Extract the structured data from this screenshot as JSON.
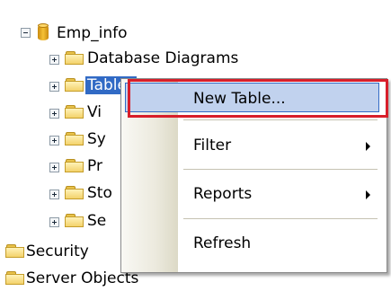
{
  "tree": {
    "root": {
      "label": "Emp_info",
      "expanded": true
    },
    "children": [
      {
        "label": "Database Diagrams"
      },
      {
        "label": "Tables",
        "selected": true,
        "visible_text": "Tables"
      },
      {
        "label": "Vi"
      },
      {
        "label": "Sy"
      },
      {
        "label": "Pr"
      },
      {
        "label": "Sto"
      },
      {
        "label": "Se"
      }
    ],
    "siblings": [
      {
        "label": "Security"
      },
      {
        "label": "Server Objects"
      }
    ]
  },
  "context_menu": {
    "items": [
      {
        "label": "New Table...",
        "highlighted": true
      },
      {
        "label": "Filter",
        "submenu": true
      },
      {
        "label": "Reports",
        "submenu": true
      },
      {
        "label": "Refresh"
      }
    ]
  },
  "colors": {
    "selection": "#316ac5",
    "menu_highlight": "#c1d2ee",
    "annotation_box": "#d81e2a"
  }
}
